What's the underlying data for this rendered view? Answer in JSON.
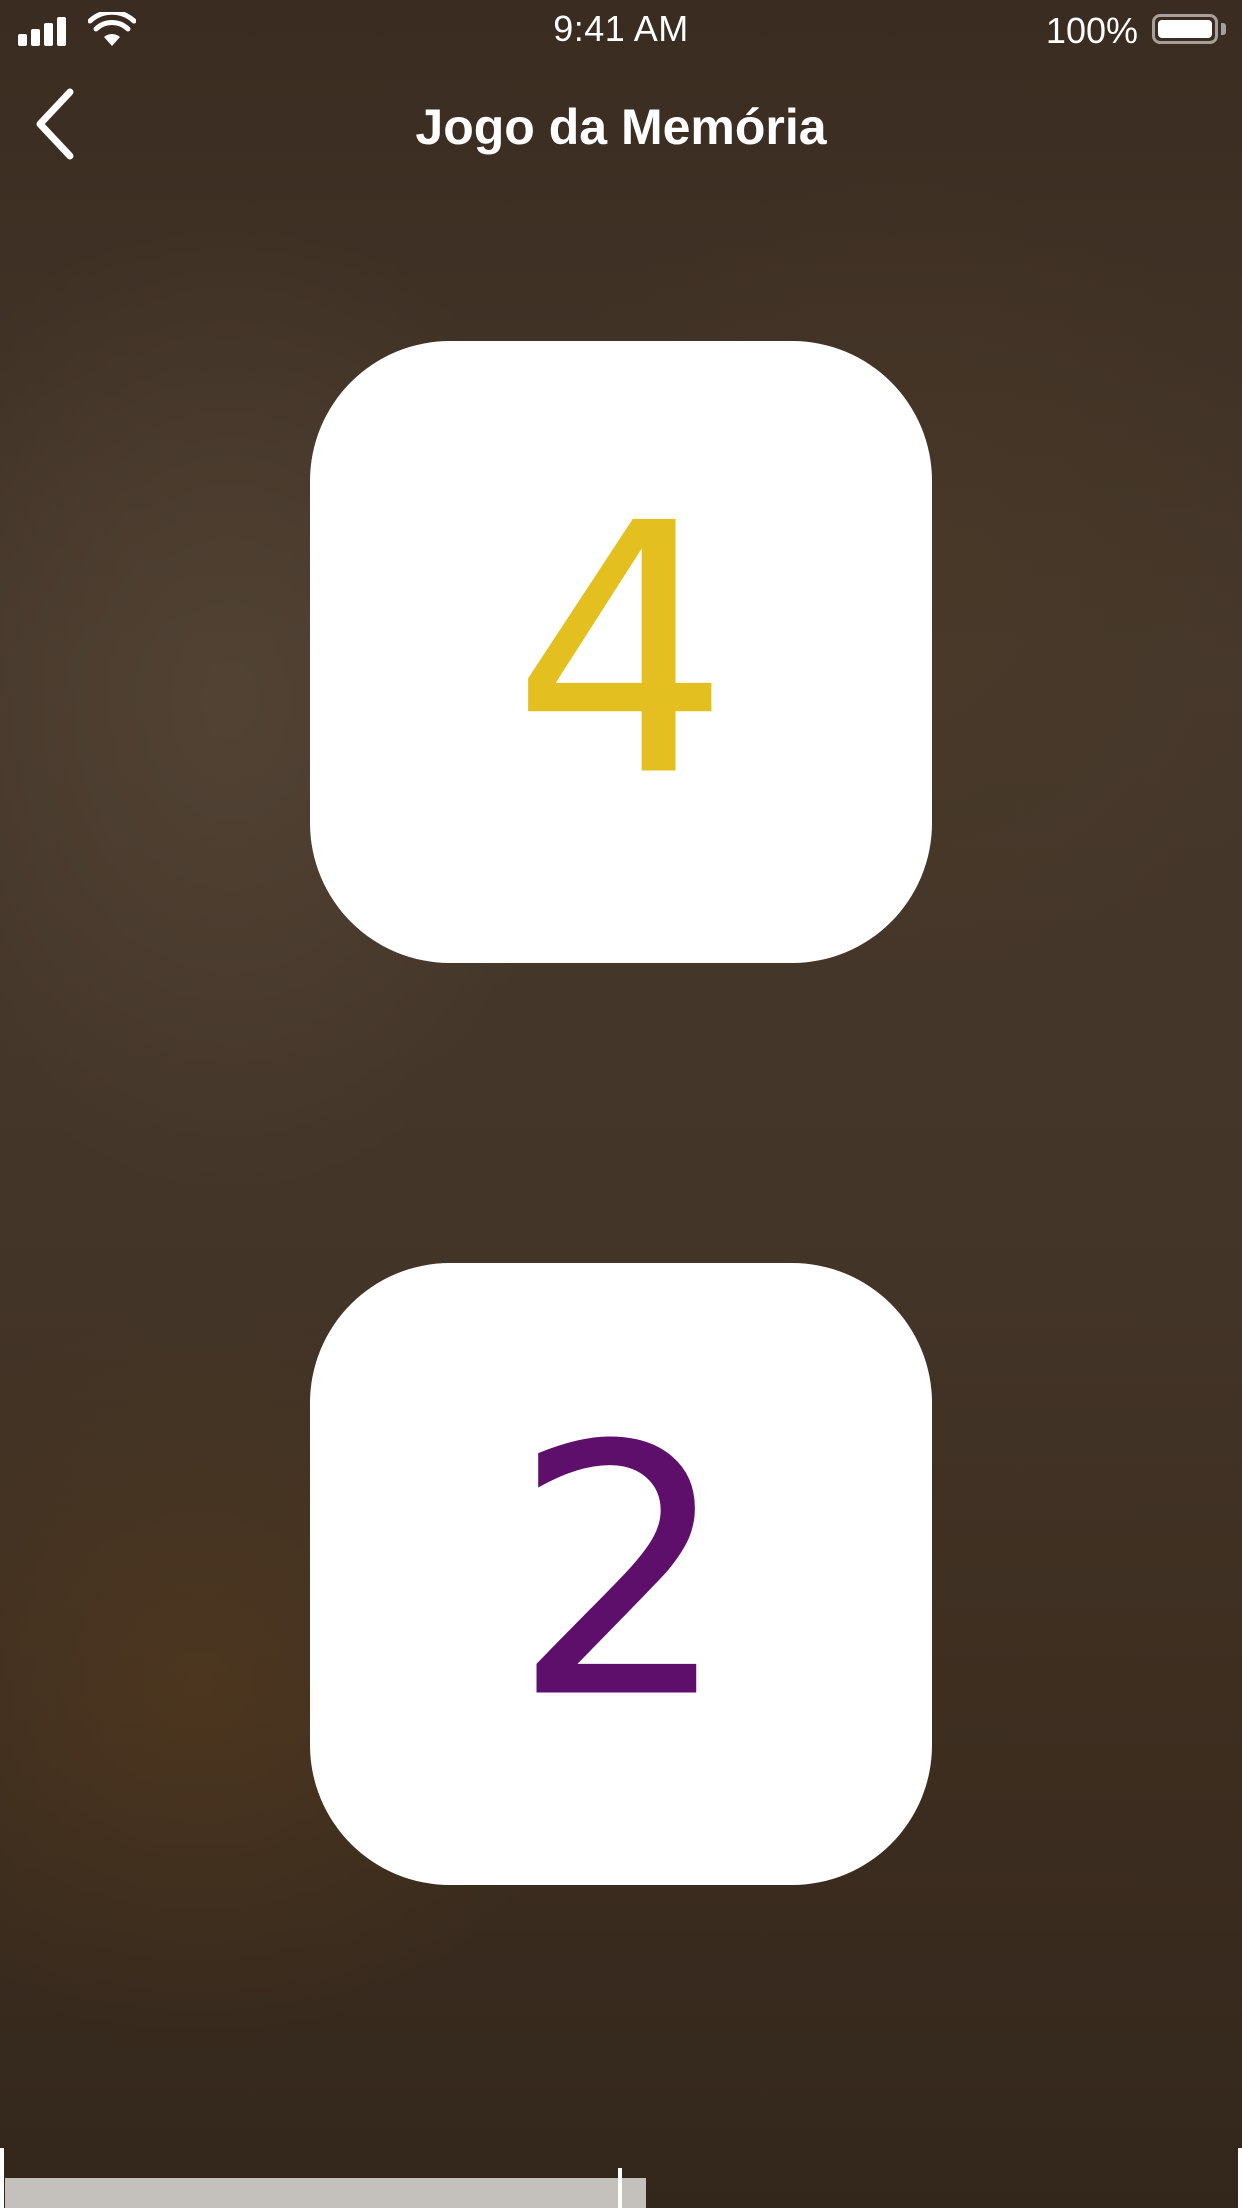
{
  "status_bar": {
    "time": "9:41 AM",
    "battery_percent_label": "100%",
    "battery_level": 1.0,
    "signal_bars": 4,
    "icons": [
      "signal-icon",
      "wifi-icon",
      "battery-icon"
    ]
  },
  "nav": {
    "title": "Jogo da Memória",
    "back_icon": "chevron-left-icon"
  },
  "cards": [
    {
      "value": "4",
      "color": "#e3bf1f"
    },
    {
      "value": "2",
      "color": "#5e0f6b"
    }
  ],
  "progress": {
    "fraction": 0.52
  },
  "colors": {
    "card_background": "#ffffff",
    "text": "#ffffff",
    "progress_track": "#c4c0bb"
  }
}
